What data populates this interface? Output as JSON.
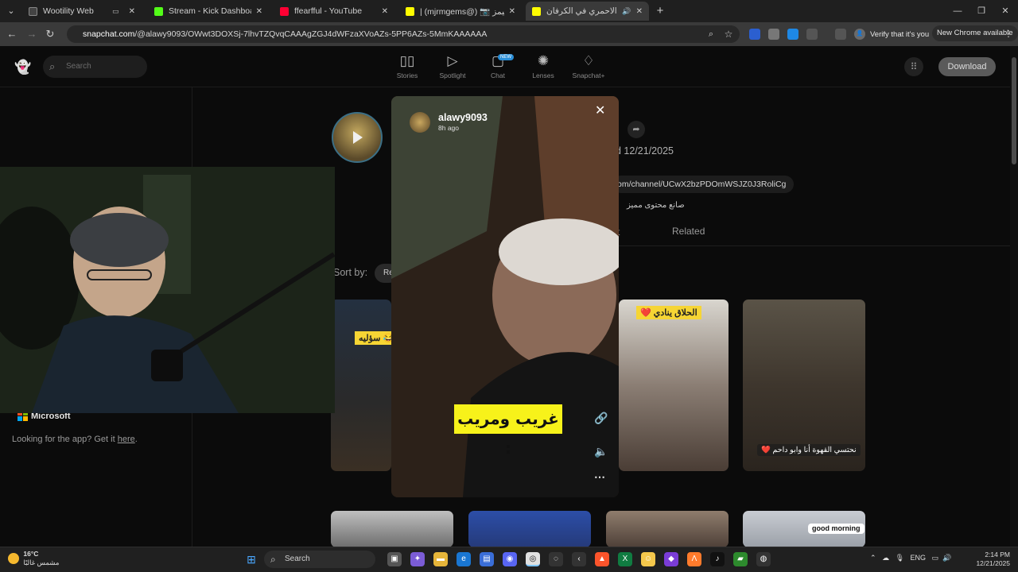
{
  "tabs": [
    {
      "title": "Wootility Web",
      "active": false
    },
    {
      "title": "Stream - Kick Dashboard",
      "active": false
    },
    {
      "title": "ffearfful - YouTube",
      "active": false
    },
    {
      "title": "| (mjrmgems@) 📷 مجرم قيمز",
      "active": false
    },
    {
      "title": "علي | الاحمري في الكرفان",
      "active": true
    }
  ],
  "address": {
    "url_host": "snapchat.com",
    "url_path": "/@alawy9093/OWwt3DOXSj-7lhvTZQvqCAAAgZGJ4dWFzaXVoAZs-5PP6AZs-5MmKAAAAAA"
  },
  "toolbar": {
    "verify_label": "Verify that it's you",
    "new_chrome_label": "New Chrome available"
  },
  "snap_header": {
    "search_placeholder": "Search",
    "nav": [
      {
        "label": "Stories",
        "icon": "stories-icon"
      },
      {
        "label": "Spotlight",
        "icon": "spotlight-icon"
      },
      {
        "label": "Chat",
        "icon": "chat-icon"
      },
      {
        "label": "Lenses",
        "icon": "lenses-icon"
      },
      {
        "label": "Snapchat+",
        "icon": "snapchat-plus-icon"
      }
    ],
    "chat_badge": "NEW",
    "download_label": "Download"
  },
  "profile": {
    "date": "d 12/21/2025",
    "channel_link": "om/channel/UCwX2bzPDOmWSJZ0J3RoliCg",
    "bio": "صانع محتوى مميز",
    "tab_partial": "t",
    "tab_related": "Related"
  },
  "sort": {
    "label": "Sort by:",
    "value": "Re"
  },
  "story": {
    "username": "alawy9093",
    "time": "8h ago",
    "subtitle": "غريب ومريب :"
  },
  "cards": [
    {
      "caption": "سؤليه 😂"
    },
    {
      "caption": "❤️ الحلاق ينادي"
    },
    {
      "caption": "❤️ نحتسي القهوة أنا وابو داحم"
    },
    {
      "caption": "good morning"
    }
  ],
  "sidebar": {
    "microsoft_label": "Microsoft",
    "looking_text": "Looking for the app? Get it ",
    "here_link": "here",
    "looking_end": "."
  },
  "taskbar": {
    "temperature": "16°C",
    "weather_desc": "مشمس غالبًا",
    "search_label": "Search",
    "language": "ENG",
    "time": "2:14 PM",
    "date": "12/21/2025"
  },
  "colors": {
    "accent": "#2a8fd8",
    "subtitle_bg": "#f7f21a",
    "card_caption_bg": "#f6d534"
  }
}
